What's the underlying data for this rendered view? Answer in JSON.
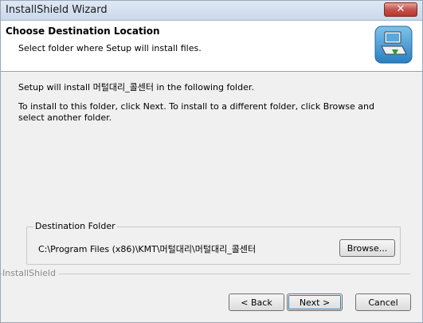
{
  "window": {
    "title": "InstallShield Wizard",
    "close_glyph": "✕"
  },
  "header": {
    "title": "Choose Destination Location",
    "subtitle": "Select folder where Setup will install files.",
    "icon": "computer-install-icon"
  },
  "body": {
    "line1": "Setup will install 머털대리_콜센터 in the following folder.",
    "line2": "To install to this folder, click Next. To install to a different folder, click Browse and select another folder."
  },
  "destination": {
    "legend": "Destination Folder",
    "path": "C:\\Program Files (x86)\\KMT\\머털대리\\머털대리_콜센터",
    "browse_label": "Browse..."
  },
  "footer": {
    "brand": "InstallShield",
    "back_label": "< Back",
    "next_label": "Next >",
    "cancel_label": "Cancel"
  }
}
